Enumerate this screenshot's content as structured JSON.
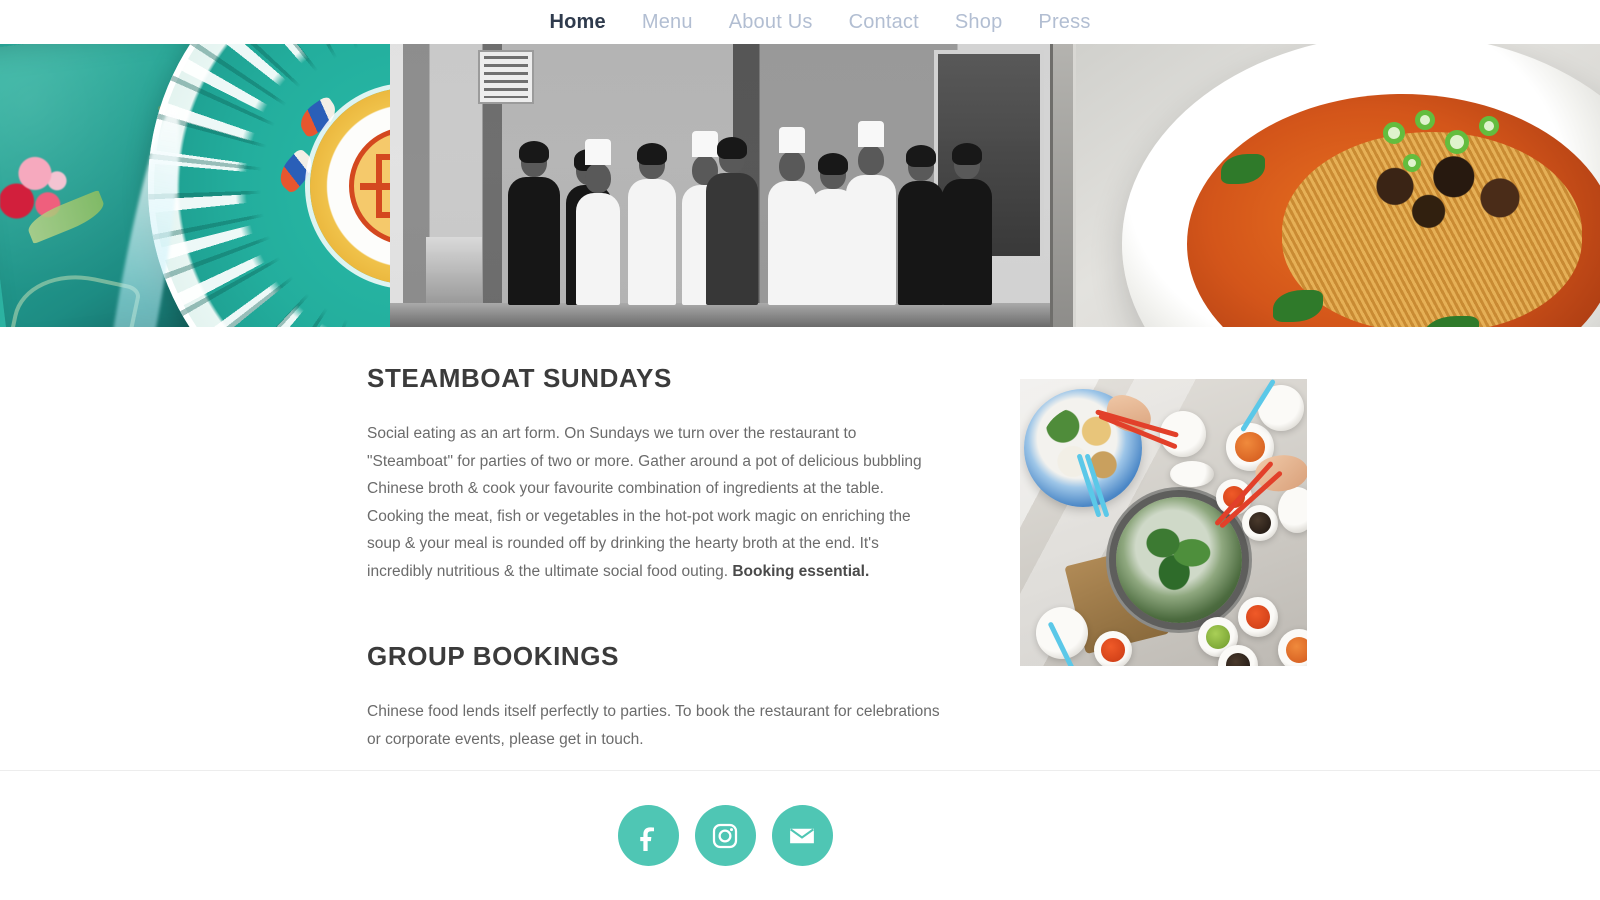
{
  "site": {
    "accent_color": "#4fc6b4",
    "nav_active_color": "#2f3b4d",
    "nav_inactive_color": "#b2bed2",
    "heading_color": "#3b3b3b",
    "body_color": "#6b6b6b"
  },
  "nav": {
    "items": [
      {
        "label": "Home",
        "active": true
      },
      {
        "label": "Menu",
        "active": false
      },
      {
        "label": "About Us",
        "active": false
      },
      {
        "label": "Contact",
        "active": false
      },
      {
        "label": "Shop",
        "active": false
      },
      {
        "label": "Press",
        "active": false
      }
    ]
  },
  "hero": {
    "images": [
      {
        "name": "turquoise-chinoiserie-plate",
        "alt": "Turquoise Chinese porcelain plate with phoenix feathers and shou longevity medallion on embroidered silk"
      },
      {
        "name": "vintage-staff-group-photo",
        "alt": "Vintage black and white photograph of restaurant staff in chef whites and tuxedos outside the restaurant"
      },
      {
        "name": "noodle-soup-bowl",
        "alt": "Bowl of noodle soup in spicy orange broth topped with spring onions, mushrooms and greens"
      }
    ]
  },
  "main": {
    "sections": [
      {
        "title": "STEAMBOAT SUNDAYS",
        "paragraph_lead": "Social eating as an art form.  On Sundays we turn over the restaurant to \"Steamboat\" for parties of two or more.  Gather around a pot of delicious bubbling Chinese broth & cook your favourite combination of ingredients at the table.  Cooking the meat, fish or vegetables in the hot-pot work magic on enriching the soup & your meal is rounded off by drinking the hearty broth at the end. It's incredibly nutritious & the ultimate social food outing. ",
        "paragraph_bold": "Booking essential."
      },
      {
        "title": "GROUP BOOKINGS",
        "paragraph_lead": "Chinese food lends itself perfectly to parties.  To book the restaurant for celebrations or corporate events, please get in touch.",
        "paragraph_bold": ""
      }
    ],
    "feature_image": {
      "name": "steamboat-hotpot-table",
      "alt": "Overhead view of a steamboat hotpot spread with red chopsticks, vegetables, tofu and dipping sauces on a marble table"
    }
  },
  "footer": {
    "social": [
      {
        "icon": "facebook-icon",
        "label": "Facebook"
      },
      {
        "icon": "instagram-icon",
        "label": "Instagram"
      },
      {
        "icon": "mail-icon",
        "label": "Email"
      }
    ]
  }
}
